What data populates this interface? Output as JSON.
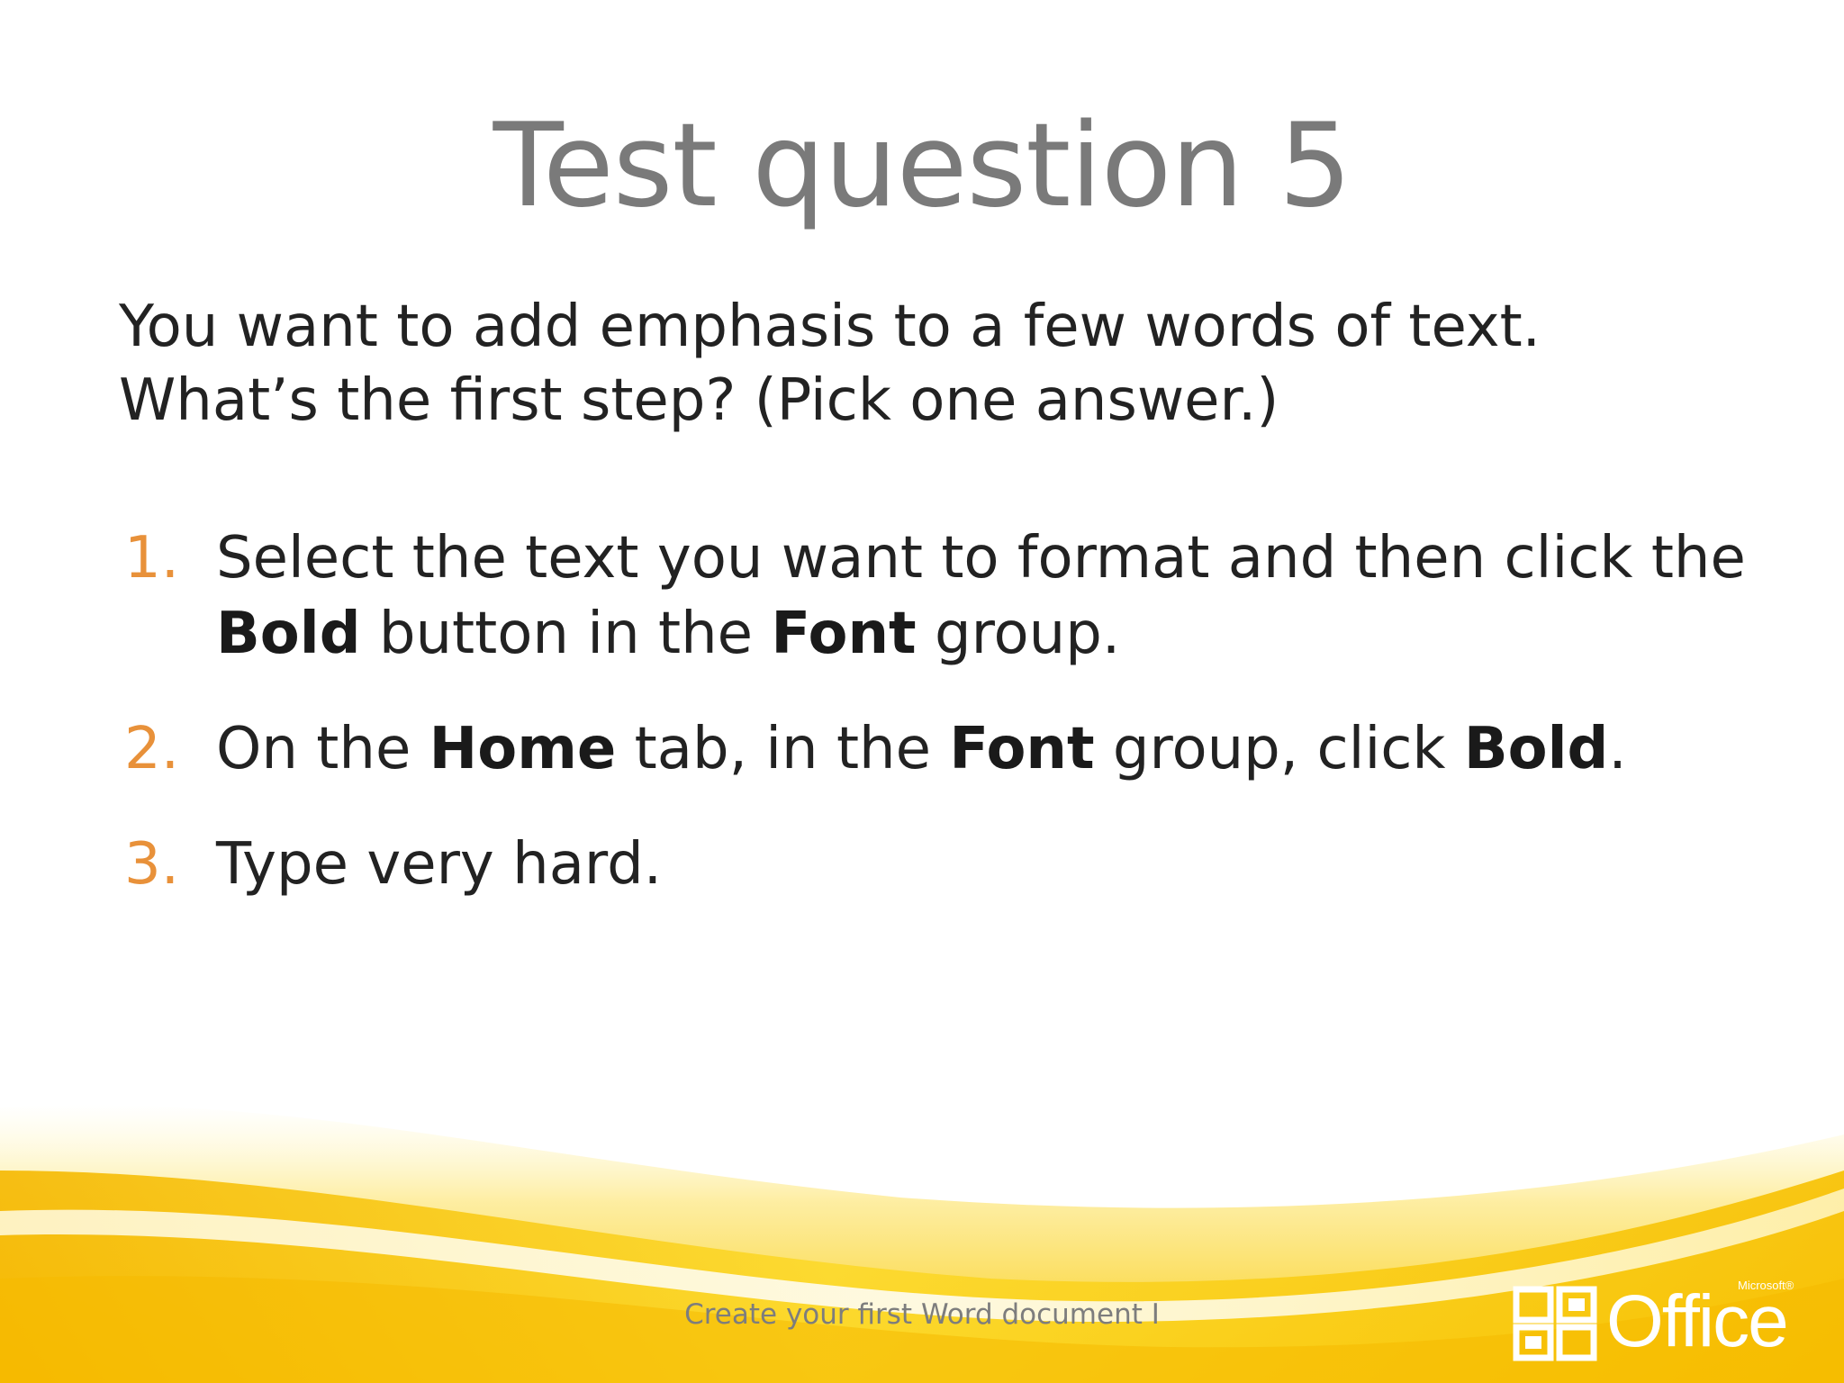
{
  "slide": {
    "title": "Test question 5",
    "question_lines": [
      "You want to add emphasis to a few words of text.",
      "What’s the first step? (Pick one answer.)"
    ],
    "answers": [
      {
        "number": "1.",
        "line1": "Select the text you want to format and then click the",
        "line2_parts": [
          {
            "text": "Bold",
            "bold": true
          },
          {
            "text": " button in the ",
            "bold": false
          },
          {
            "text": "Font",
            "bold": true
          },
          {
            "text": " group.",
            "bold": false
          }
        ]
      },
      {
        "number": "2.",
        "parts": [
          {
            "text": "On the ",
            "bold": false
          },
          {
            "text": "Home",
            "bold": true
          },
          {
            "text": " tab, in the ",
            "bold": false
          },
          {
            "text": "Font",
            "bold": true
          },
          {
            "text": " group, click ",
            "bold": false
          },
          {
            "text": "Bold",
            "bold": true
          },
          {
            "text": ".",
            "bold": false
          }
        ]
      },
      {
        "number": "3.",
        "text": "Type very hard."
      }
    ],
    "footer": "Create your first Word document I",
    "logo": {
      "word": "Office",
      "superscript": "Microsoft®",
      "icon": "office-logo-icon"
    }
  },
  "colors": {
    "title": "#7a7a7a",
    "body_text": "#222222",
    "number": "#e8913a",
    "swoosh_yellow": "#f7c600",
    "swoosh_light": "#fff3a8",
    "footer": "#7d7d7d"
  }
}
